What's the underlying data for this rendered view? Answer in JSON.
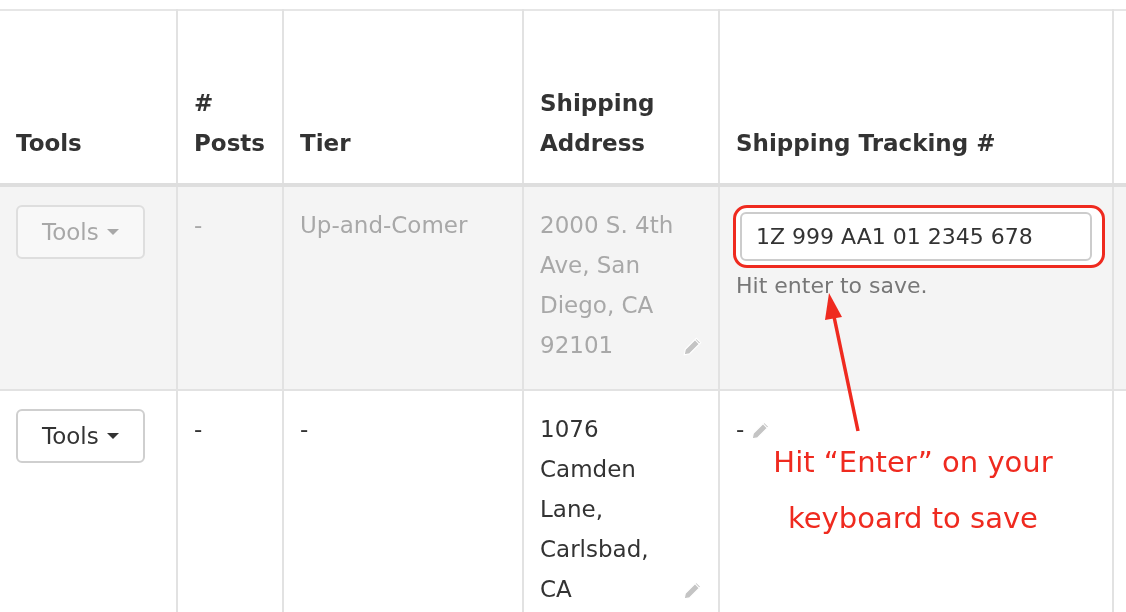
{
  "table": {
    "columns": [
      "Tools",
      "# Posts",
      "Tier",
      "Shipping Address",
      "Shipping Tracking #"
    ],
    "rows": [
      {
        "disabled": true,
        "tools": "Tools",
        "posts": "-",
        "tier": "Up-and-Comer",
        "address": "2000 S. 4th Ave, San Diego, CA 92101",
        "tracking": {
          "kind": "input",
          "value": "1Z 999 AA1 01 2345 678",
          "hint": "Hit enter to save."
        }
      },
      {
        "disabled": false,
        "tools": "Tools",
        "posts": "-",
        "tier": "-",
        "address": "1076 Camden Lane, Carlsbad, CA",
        "tracking": {
          "kind": "text",
          "value": "-"
        }
      }
    ]
  },
  "annotation": {
    "text": "Hit “Enter” on your keyboard to save"
  }
}
